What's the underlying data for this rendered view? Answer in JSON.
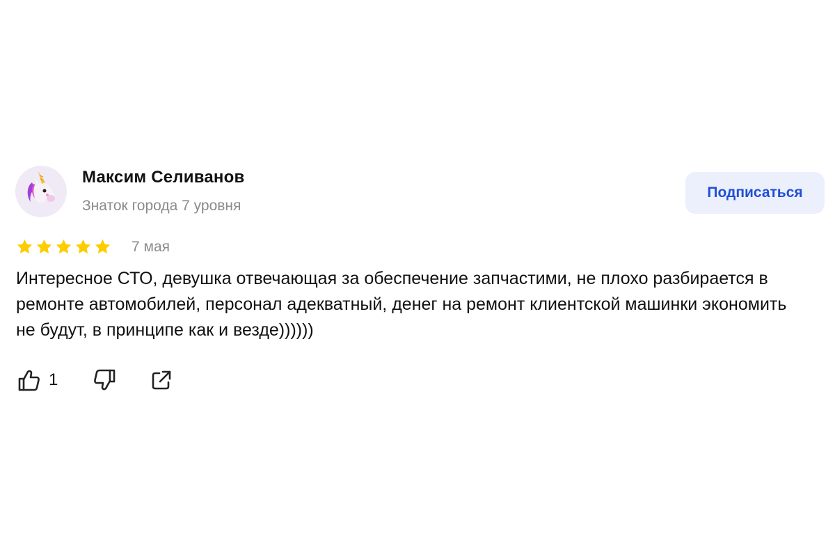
{
  "review": {
    "author": {
      "name": "Максим Селиванов",
      "level": "Знаток города 7 уровня",
      "avatar_icon": "unicorn-icon"
    },
    "subscribe_label": "Подписаться",
    "rating": {
      "value": 5,
      "max": 5,
      "star_color": "#ffcc00"
    },
    "date": "7 мая",
    "text": "Интересное СТО, девушка отвечающая за обеспечение запчастими, не плохо разбирается в ремонте автомобилей, персонал адекватный, денег на ремонт клиентской машинки экономить не будут, в принципе как и везде))))))",
    "actions": {
      "like_icon": "thumbs-up-icon",
      "like_count": "1",
      "dislike_icon": "thumbs-down-icon",
      "share_icon": "share-icon"
    }
  },
  "colors": {
    "accent": "#1f4fd4",
    "subscribe_bg": "#ecf0fd",
    "muted_text": "#8a8a8a"
  }
}
